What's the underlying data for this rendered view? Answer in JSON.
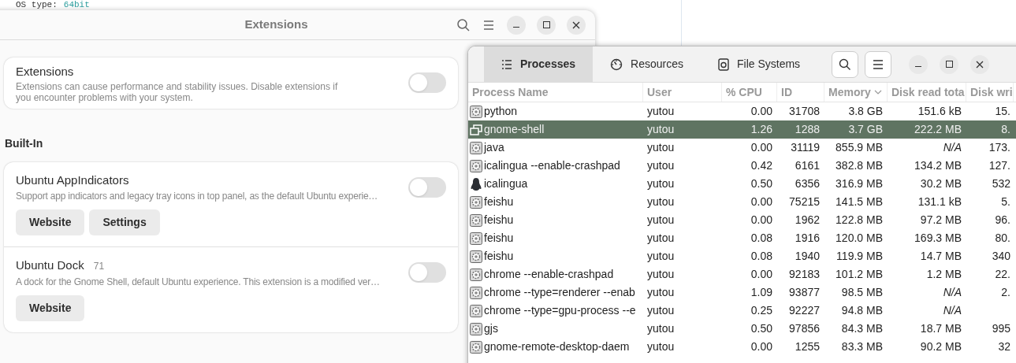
{
  "terminal_line": {
    "label": "OS type:",
    "value": "64bit"
  },
  "extensions_window": {
    "title": "Extensions",
    "main_row": {
      "title": "Extensions",
      "description": "Extensions can cause performance and stability issues. Disable extensions if you encounter problems with your system.",
      "on": false
    },
    "section_title": "Built-In",
    "extensions": [
      {
        "name": "Ubuntu AppIndicators",
        "description": "Support app indicators and legacy tray icons in top panel, as the default Ubuntu experie…",
        "on": false,
        "buttons": [
          "Website",
          "Settings"
        ]
      },
      {
        "name": "Ubuntu Dock",
        "version": "71",
        "description": "A dock for the Gnome Shell, default Ubuntu experience. This extension is a modified ver…",
        "on": false,
        "buttons": [
          "Website"
        ]
      }
    ]
  },
  "system_monitor": {
    "tabs": [
      {
        "label": "Processes",
        "selected": true
      },
      {
        "label": "Resources",
        "selected": false
      },
      {
        "label": "File Systems",
        "selected": false
      }
    ],
    "table": {
      "columns": [
        "Process Name",
        "User",
        "% CPU",
        "ID",
        "Memory",
        "Disk read tota",
        "Disk wri"
      ],
      "rows": [
        {
          "kind": "generic",
          "selected": false,
          "cells": [
            "python",
            "yutou",
            "0.00",
            "31708",
            "3.8 GB",
            "151.6 kB",
            "15."
          ]
        },
        {
          "kind": "window",
          "selected": true,
          "cells": [
            "gnome-shell",
            "yutou",
            "1.26",
            "1288",
            "3.7 GB",
            "222.2 MB",
            "8."
          ]
        },
        {
          "kind": "generic",
          "selected": false,
          "cells": [
            "java",
            "yutou",
            "0.00",
            "31119",
            "855.9 MB",
            "N/A",
            "173."
          ]
        },
        {
          "kind": "generic",
          "selected": false,
          "cells": [
            "icalingua --enable-crashpad",
            "yutou",
            "0.42",
            "6161",
            "382.8 MB",
            "134.2 MB",
            "127."
          ]
        },
        {
          "kind": "penguin",
          "selected": false,
          "cells": [
            "icalingua",
            "yutou",
            "0.50",
            "6356",
            "316.9 MB",
            "30.2 MB",
            "532"
          ]
        },
        {
          "kind": "generic",
          "selected": false,
          "cells": [
            "feishu",
            "yutou",
            "0.00",
            "75215",
            "141.5 MB",
            "131.1 kB",
            "5."
          ]
        },
        {
          "kind": "generic",
          "selected": false,
          "cells": [
            "feishu",
            "yutou",
            "0.00",
            "1962",
            "122.8 MB",
            "97.2 MB",
            "96."
          ]
        },
        {
          "kind": "generic",
          "selected": false,
          "cells": [
            "feishu",
            "yutou",
            "0.08",
            "1916",
            "120.0 MB",
            "169.3 MB",
            "80."
          ]
        },
        {
          "kind": "generic",
          "selected": false,
          "cells": [
            "feishu",
            "yutou",
            "0.08",
            "1940",
            "119.9 MB",
            "14.7 MB",
            "340"
          ]
        },
        {
          "kind": "generic",
          "selected": false,
          "cells": [
            "chrome --enable-crashpad",
            "yutou",
            "0.00",
            "92183",
            "101.2 MB",
            "1.2 MB",
            "22."
          ]
        },
        {
          "kind": "generic",
          "selected": false,
          "cells": [
            "chrome --type=renderer --enab",
            "yutou",
            "1.09",
            "93877",
            "98.5 MB",
            "N/A",
            "2."
          ]
        },
        {
          "kind": "generic",
          "selected": false,
          "cells": [
            "chrome --type=gpu-process --e",
            "yutou",
            "0.25",
            "92227",
            "94.8 MB",
            "N/A",
            ""
          ]
        },
        {
          "kind": "generic",
          "selected": false,
          "cells": [
            "gjs",
            "yutou",
            "0.50",
            "97856",
            "84.3 MB",
            "18.7 MB",
            "995"
          ]
        },
        {
          "kind": "generic",
          "selected": false,
          "cells": [
            "gnome-remote-desktop-daem",
            "yutou",
            "0.00",
            "1255",
            "83.3 MB",
            "90.2 MB",
            "32"
          ]
        }
      ]
    }
  }
}
